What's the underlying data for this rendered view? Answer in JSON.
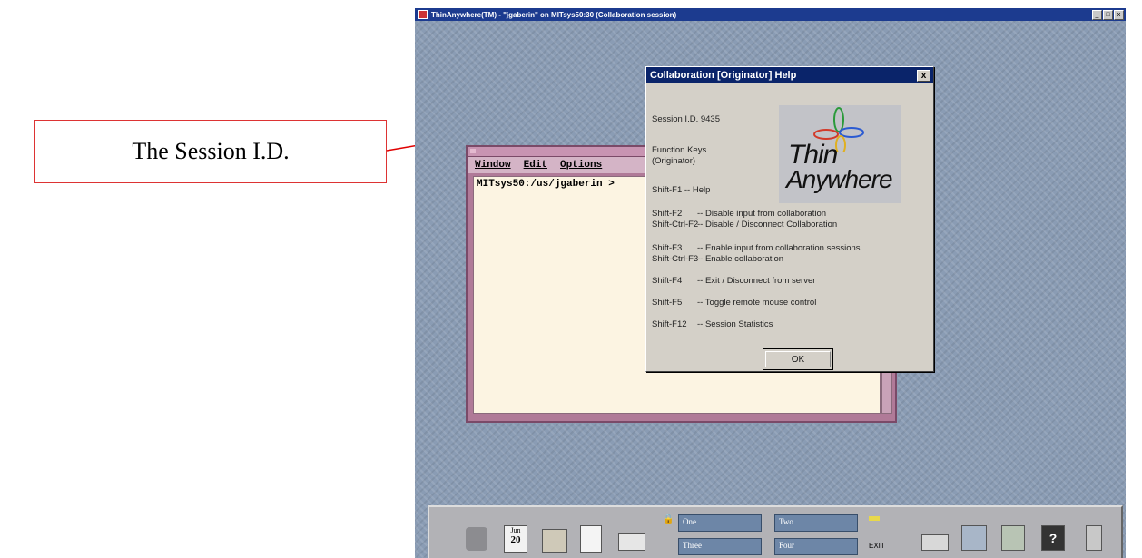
{
  "callout": {
    "text": "The Session I.D."
  },
  "window": {
    "title": "ThinAnywhere(TM) - \"jgaberin\" on MITsys50:30 (Collaboration session)",
    "controls": [
      "_",
      "□",
      "x"
    ]
  },
  "terminal": {
    "menu": [
      "Window",
      "Edit",
      "Options"
    ],
    "prompt": "MITsys50:/us/jgaberin >"
  },
  "help_dialog": {
    "title": "Collaboration [Originator] Help",
    "close_label": "x",
    "session_id": "Session I.D. 9435",
    "function_keys_heading": "Function Keys",
    "function_keys_sub": "(Originator)",
    "logo_line1": "Thin",
    "logo_line2": "Anywhere",
    "help_line": "Shift-F1 -- Help",
    "keys": [
      {
        "key": "Shift-F2",
        "desc": "-- Disable input from collaboration"
      },
      {
        "key": "Shift-Ctrl-F2",
        "desc": "-- Disable / Disconnect Collaboration"
      },
      {
        "key": "Shift-F3",
        "desc": "-- Enable input from collaboration sessions"
      },
      {
        "key": "Shift-Ctrl-F3",
        "desc": "-- Enable collaboration"
      },
      {
        "key": "Shift-F4",
        "desc": "-- Exit / Disconnect from server"
      },
      {
        "key": "Shift-F5",
        "desc": "-- Toggle remote mouse control"
      },
      {
        "key": "Shift-F12",
        "desc": "-- Session Statistics"
      }
    ],
    "ok_label": "OK"
  },
  "front_panel": {
    "date_month": "Jun",
    "date_day": "20",
    "workspaces": [
      "One",
      "Two",
      "Three",
      "Four"
    ],
    "exit_label": "EXIT"
  }
}
